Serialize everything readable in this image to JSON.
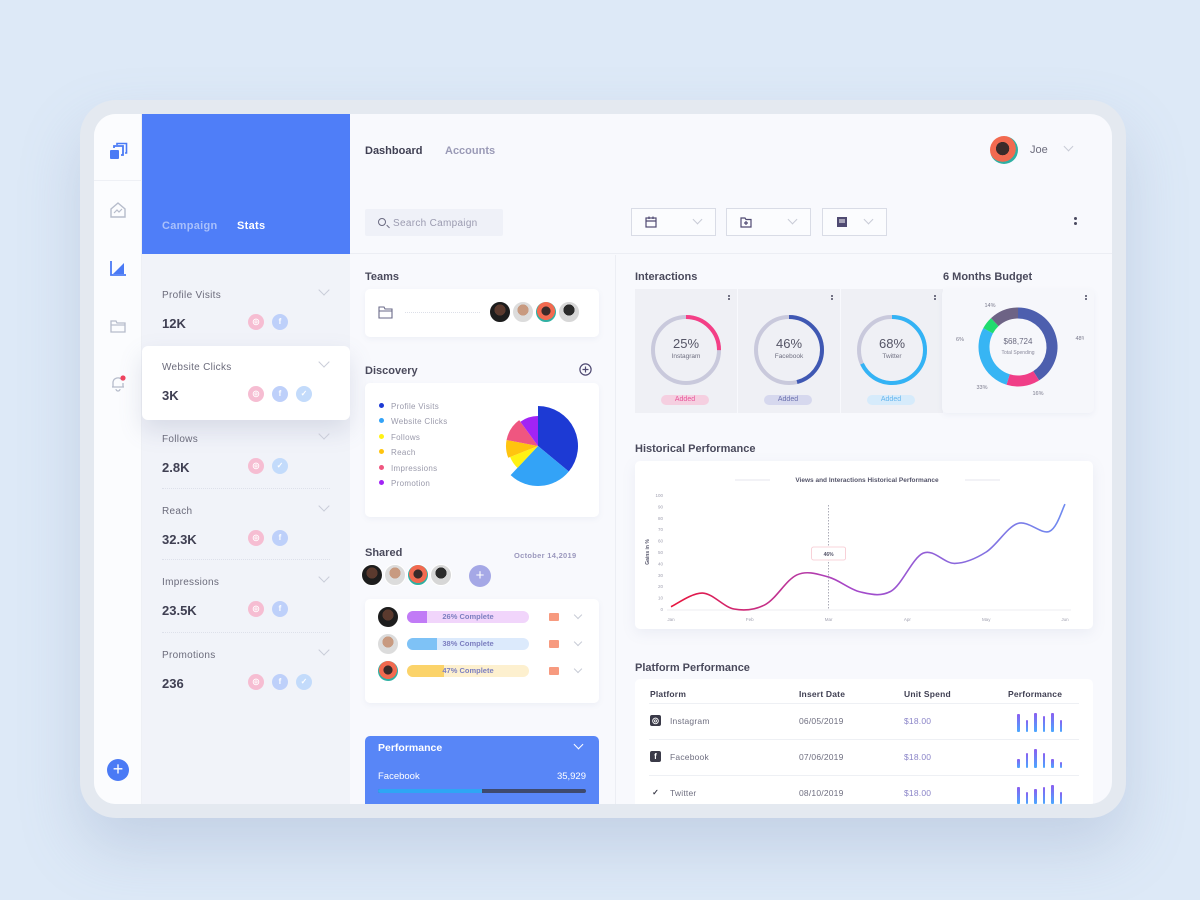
{
  "nav": {
    "tabs": [
      "Dashboard",
      "Accounts"
    ],
    "active_tab": "Dashboard",
    "user_name": "Joe",
    "search_placeholder": "Search Campaign"
  },
  "rail": {
    "icons": [
      "layers-logo-icon",
      "home-chart-icon",
      "area-chart-icon",
      "folder-icon",
      "bell-icon"
    ],
    "add_label": "+"
  },
  "stats_panel": {
    "tabs": [
      "Campaign",
      "Stats"
    ],
    "active_tab": "Stats",
    "items": [
      {
        "label": "Profile Visits",
        "value": "12K",
        "platforms": [
          "instagram",
          "facebook"
        ]
      },
      {
        "label": "Website Clicks",
        "value": "3K",
        "platforms": [
          "instagram",
          "facebook",
          "twitter"
        ],
        "active": true
      },
      {
        "label": "Follows",
        "value": "2.8K",
        "platforms": [
          "instagram",
          "twitter"
        ]
      },
      {
        "label": "Reach",
        "value": "32.3K",
        "platforms": [
          "instagram",
          "facebook"
        ]
      },
      {
        "label": "Impressions",
        "value": "23.5K",
        "platforms": [
          "instagram",
          "facebook"
        ]
      },
      {
        "label": "Promotions",
        "value": "236",
        "platforms": [
          "instagram",
          "facebook",
          "twitter"
        ]
      }
    ]
  },
  "teams": {
    "title": "Teams",
    "member_count": 4
  },
  "discovery": {
    "title": "Discovery",
    "legend": [
      {
        "label": "Profile Visits",
        "color": "#1d3ad4"
      },
      {
        "label": "Website Clicks",
        "color": "#33a3f7"
      },
      {
        "label": "Follows",
        "color": "#fff214"
      },
      {
        "label": "Reach",
        "color": "#ffc40f"
      },
      {
        "label": "Impressions",
        "color": "#ef5680"
      },
      {
        "label": "Promotion",
        "color": "#a224f5"
      }
    ],
    "slices": [
      36,
      26,
      7,
      9,
      12,
      10
    ]
  },
  "shared": {
    "title": "Shared",
    "date": "October 14,2019",
    "add_label": "+",
    "tasks": [
      {
        "progress": 26,
        "label": "26% Complete",
        "color": "#c17bf6",
        "track": "#f1d5fb"
      },
      {
        "progress": 38,
        "label": "38% Complete",
        "color": "#7ec2f6",
        "track": "#dceafc"
      },
      {
        "progress": 47,
        "label": "47% Complete",
        "color": "#fbd36a",
        "track": "#fdf0cf"
      }
    ]
  },
  "performance": {
    "title": "Performance",
    "platform": "Facebook",
    "value": "35,929",
    "progress": 50
  },
  "interactions": {
    "title": "Interactions",
    "rings": [
      {
        "pct": 25,
        "label": "25%",
        "name": "Instagram",
        "color": "#f43f86",
        "badge": "Added",
        "badge_bg": "#f5cfe0",
        "badge_fg": "#e8559a"
      },
      {
        "pct": 46,
        "label": "46%",
        "name": "Facebook",
        "color": "#3f58b3",
        "badge": "Added",
        "badge_bg": "#d6d8ee",
        "badge_fg": "#6a70ae"
      },
      {
        "pct": 68,
        "label": "68%",
        "name": "Twitter",
        "color": "#33b3f5",
        "badge": "Added",
        "badge_bg": "#d6ebfb",
        "badge_fg": "#64b5ee"
      }
    ]
  },
  "budget": {
    "title": "6 Months Budget",
    "total": "$68,724",
    "total_label": "Total Spending",
    "segments": [
      {
        "pct": 48,
        "label": "48%",
        "color": "#4d5fae"
      },
      {
        "pct": 16,
        "label": "16%",
        "color": "#f03e87"
      },
      {
        "pct": 33,
        "label": "33%",
        "color": "#37b5f4"
      },
      {
        "pct": 6,
        "label": "6%",
        "color": "#20dc6e"
      },
      {
        "pct": 14,
        "label": "14%",
        "color": "#6d6385"
      }
    ]
  },
  "historical": {
    "title": "Historical Performance",
    "chart_title": "Views and Interactions Historical Performance",
    "ylabel": "Gains in %",
    "tooltip": "46%"
  },
  "chart_data": {
    "type": "line",
    "title": "Views and Interactions Historical Performance",
    "xlabel": "",
    "ylabel": "Gains in %",
    "categories": [
      "Jan",
      "Feb",
      "Mar",
      "Apr",
      "May",
      "Jun"
    ],
    "x": [
      0,
      0.4,
      0.8,
      1.2,
      1.6,
      2.0,
      2.4,
      2.8,
      3.2,
      3.6,
      4.0,
      4.4,
      4.8,
      5.0
    ],
    "series": [
      {
        "name": "Gains",
        "values": [
          2,
          14,
          0,
          4,
          30,
          28,
          15,
          16,
          49,
          40,
          50,
          75,
          68,
          92
        ]
      }
    ],
    "ylim": [
      0,
      100
    ],
    "yticks": [
      0,
      10,
      20,
      30,
      40,
      50,
      60,
      70,
      80,
      90,
      100
    ],
    "annotation": {
      "x": 2,
      "label": "46%"
    },
    "grid": false
  },
  "platform_performance": {
    "title": "Platform Performance",
    "columns": [
      "Platform",
      "Insert Date",
      "Unit Spend",
      "Performance"
    ],
    "rows": [
      {
        "platform": "Instagram",
        "icon": "instagram-icon",
        "date": "06/05/2019",
        "spend": "$18.00",
        "bars": [
          0.9,
          0.6,
          0.95,
          0.8,
          0.95,
          0.6
        ]
      },
      {
        "platform": "Facebook",
        "icon": "facebook-icon",
        "date": "07/06/2019",
        "spend": "$18.00",
        "bars": [
          0.45,
          0.75,
          0.95,
          0.75,
          0.45,
          0.3
        ]
      },
      {
        "platform": "Twitter",
        "icon": "twitter-icon",
        "date": "08/10/2019",
        "spend": "$18.00",
        "bars": [
          0.85,
          0.6,
          0.75,
          0.85,
          0.95,
          0.6
        ]
      }
    ]
  }
}
